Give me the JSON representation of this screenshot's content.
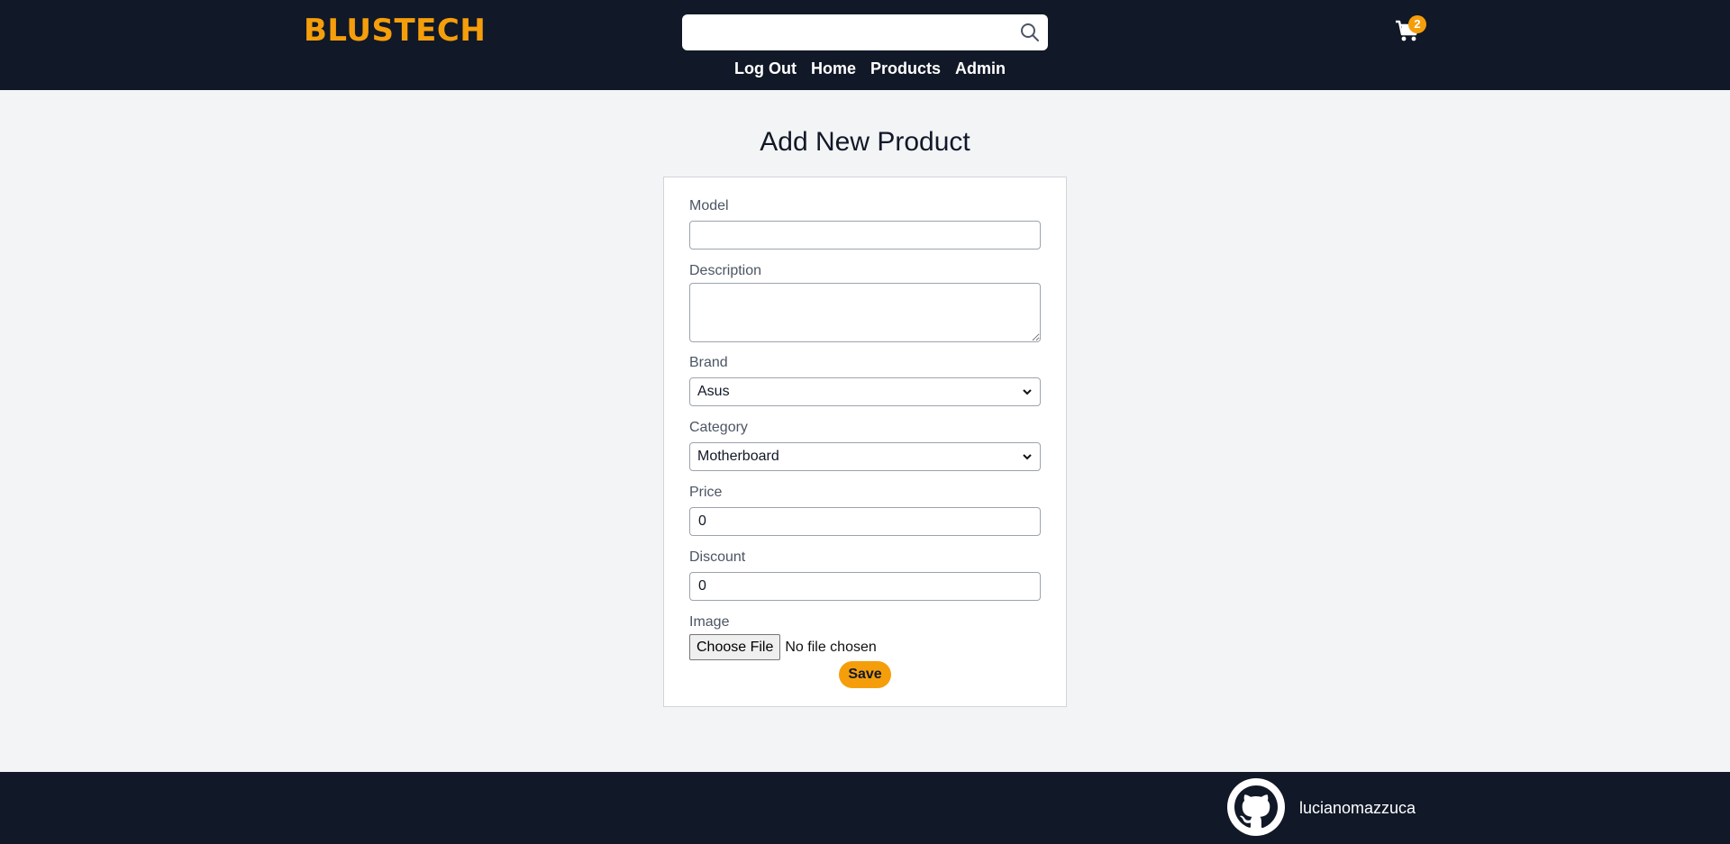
{
  "header": {
    "logo": "BLUSTECH",
    "search": {
      "value": "",
      "placeholder": ""
    },
    "cart": {
      "count": "2"
    },
    "nav": [
      {
        "label": "Log Out"
      },
      {
        "label": "Home"
      },
      {
        "label": "Products"
      },
      {
        "label": "Admin"
      }
    ]
  },
  "main": {
    "title": "Add New Product",
    "form": {
      "model": {
        "label": "Model",
        "value": ""
      },
      "description": {
        "label": "Description",
        "value": ""
      },
      "brand": {
        "label": "Brand",
        "selected": "Asus"
      },
      "category": {
        "label": "Category",
        "selected": "Motherboard"
      },
      "price": {
        "label": "Price",
        "value": "0"
      },
      "discount": {
        "label": "Discount",
        "value": "0"
      },
      "image": {
        "label": "Image",
        "button": "Choose File",
        "status": "No file chosen"
      },
      "save_label": "Save"
    }
  },
  "footer": {
    "github_user": "lucianomazzuca"
  },
  "colors": {
    "header_bg": "#111827",
    "accent": "#f59e0b",
    "page_bg": "#f3f4f6"
  }
}
